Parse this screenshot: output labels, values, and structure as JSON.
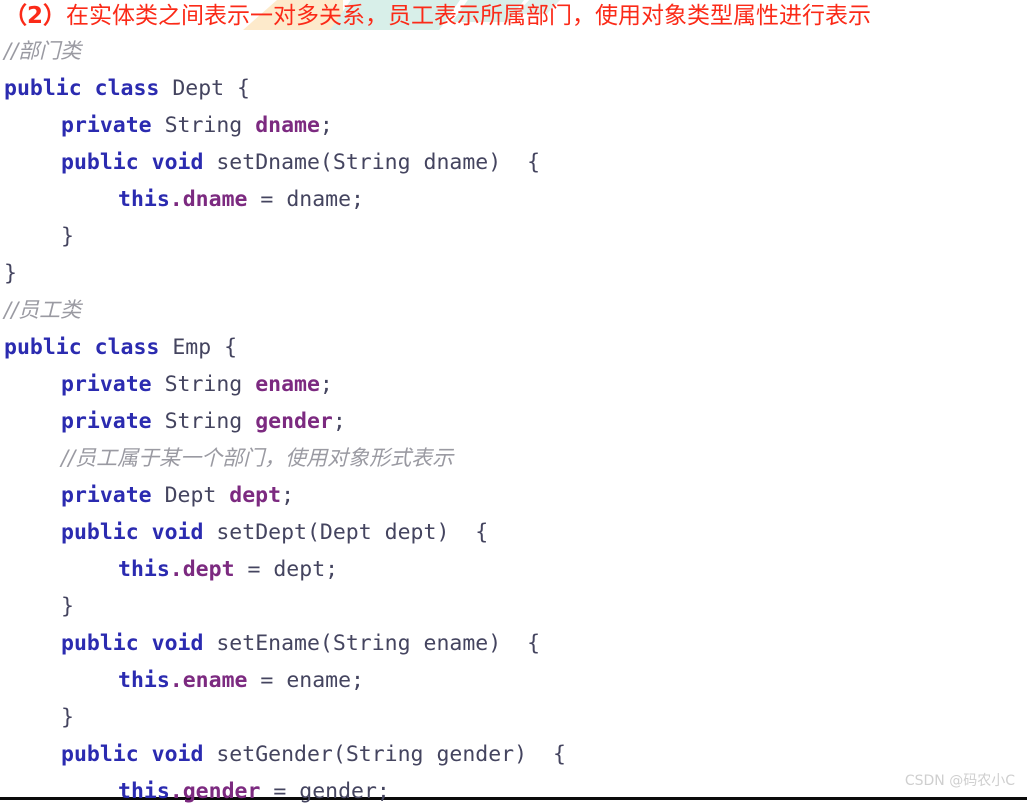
{
  "heading": {
    "index_label": "（2）",
    "text": "在实体类之间表示一对多关系，员工表示所属部门，使用对象类型属性进行表示",
    "color": "#fb2a18",
    "highlights": [
      {
        "name": "cream-wedge",
        "color": "#fdeacb"
      },
      {
        "name": "cyan-stroke-1",
        "color": "#d8efe9"
      },
      {
        "name": "cyan-stroke-2",
        "color": "#d8efe9"
      },
      {
        "name": "cyan-stroke-3",
        "color": "#dff0ec"
      }
    ]
  },
  "syntax_colors": {
    "keyword": "#2b2bb0",
    "type": "#44445f",
    "field": "#7c2a80",
    "comment": "#9a9aa2",
    "punctuation": "#44445f"
  },
  "code": {
    "language": "Java",
    "lines": [
      {
        "n": 1,
        "indent": 0,
        "tokens": [
          {
            "t": "//部门类",
            "c": "cmt"
          }
        ]
      },
      {
        "n": 2,
        "indent": 0,
        "tokens": [
          {
            "t": "public",
            "c": "kw"
          },
          {
            "t": " ",
            "c": "pun"
          },
          {
            "t": "class",
            "c": "kw"
          },
          {
            "t": " ",
            "c": "pun"
          },
          {
            "t": "Dept",
            "c": "typ"
          },
          {
            "t": " {",
            "c": "pun"
          }
        ]
      },
      {
        "n": 3,
        "indent": 1,
        "tokens": [
          {
            "t": "private",
            "c": "kw"
          },
          {
            "t": " ",
            "c": "pun"
          },
          {
            "t": "String",
            "c": "typ"
          },
          {
            "t": " ",
            "c": "pun"
          },
          {
            "t": "dname",
            "c": "fld"
          },
          {
            "t": ";",
            "c": "pun"
          }
        ]
      },
      {
        "n": 4,
        "indent": 1,
        "tokens": [
          {
            "t": "public",
            "c": "kw"
          },
          {
            "t": " ",
            "c": "pun"
          },
          {
            "t": "void",
            "c": "kw"
          },
          {
            "t": " ",
            "c": "pun"
          },
          {
            "t": "setDname",
            "c": "mth"
          },
          {
            "t": "(",
            "c": "pun"
          },
          {
            "t": "String",
            "c": "typ"
          },
          {
            "t": " ",
            "c": "pun"
          },
          {
            "t": "dname",
            "c": "var"
          },
          {
            "t": ")  {",
            "c": "pun"
          }
        ]
      },
      {
        "n": 5,
        "indent": 2,
        "tokens": [
          {
            "t": "this",
            "c": "kw"
          },
          {
            "t": ".",
            "c": "fld"
          },
          {
            "t": "dname",
            "c": "fld"
          },
          {
            "t": " = ",
            "c": "pun"
          },
          {
            "t": "dname",
            "c": "var"
          },
          {
            "t": ";",
            "c": "pun"
          }
        ]
      },
      {
        "n": 6,
        "indent": 1,
        "tokens": [
          {
            "t": "}",
            "c": "pun"
          }
        ]
      },
      {
        "n": 7,
        "indent": 0,
        "tokens": [
          {
            "t": "}",
            "c": "pun"
          }
        ]
      },
      {
        "n": 8,
        "indent": 0,
        "tokens": [
          {
            "t": "//员工类",
            "c": "cmt"
          }
        ]
      },
      {
        "n": 9,
        "indent": 0,
        "tokens": [
          {
            "t": "public",
            "c": "kw"
          },
          {
            "t": " ",
            "c": "pun"
          },
          {
            "t": "class",
            "c": "kw"
          },
          {
            "t": " ",
            "c": "pun"
          },
          {
            "t": "Emp",
            "c": "typ"
          },
          {
            "t": " {",
            "c": "pun"
          }
        ]
      },
      {
        "n": 10,
        "indent": 1,
        "tokens": [
          {
            "t": "private",
            "c": "kw"
          },
          {
            "t": " ",
            "c": "pun"
          },
          {
            "t": "String",
            "c": "typ"
          },
          {
            "t": " ",
            "c": "pun"
          },
          {
            "t": "ename",
            "c": "fld"
          },
          {
            "t": ";",
            "c": "pun"
          }
        ]
      },
      {
        "n": 11,
        "indent": 1,
        "tokens": [
          {
            "t": "private",
            "c": "kw"
          },
          {
            "t": " ",
            "c": "pun"
          },
          {
            "t": "String",
            "c": "typ"
          },
          {
            "t": " ",
            "c": "pun"
          },
          {
            "t": "gender",
            "c": "fld"
          },
          {
            "t": ";",
            "c": "pun"
          }
        ]
      },
      {
        "n": 12,
        "indent": 1,
        "tokens": [
          {
            "t": "//员工属于某一个部门，使用对象形式表示",
            "c": "cmt"
          }
        ]
      },
      {
        "n": 13,
        "indent": 1,
        "tokens": [
          {
            "t": "private",
            "c": "kw"
          },
          {
            "t": " ",
            "c": "pun"
          },
          {
            "t": "Dept",
            "c": "typ"
          },
          {
            "t": " ",
            "c": "pun"
          },
          {
            "t": "dept",
            "c": "fld"
          },
          {
            "t": ";",
            "c": "pun"
          }
        ]
      },
      {
        "n": 14,
        "indent": 1,
        "tokens": [
          {
            "t": "public",
            "c": "kw"
          },
          {
            "t": " ",
            "c": "pun"
          },
          {
            "t": "void",
            "c": "kw"
          },
          {
            "t": " ",
            "c": "pun"
          },
          {
            "t": "setDept",
            "c": "mth"
          },
          {
            "t": "(",
            "c": "pun"
          },
          {
            "t": "Dept",
            "c": "typ"
          },
          {
            "t": " ",
            "c": "pun"
          },
          {
            "t": "dept",
            "c": "var"
          },
          {
            "t": ")  {",
            "c": "pun"
          }
        ]
      },
      {
        "n": 15,
        "indent": 2,
        "tokens": [
          {
            "t": "this",
            "c": "kw"
          },
          {
            "t": ".",
            "c": "fld"
          },
          {
            "t": "dept",
            "c": "fld"
          },
          {
            "t": " = ",
            "c": "pun"
          },
          {
            "t": "dept",
            "c": "var"
          },
          {
            "t": ";",
            "c": "pun"
          }
        ]
      },
      {
        "n": 16,
        "indent": 1,
        "tokens": [
          {
            "t": "}",
            "c": "pun"
          }
        ]
      },
      {
        "n": 17,
        "indent": 1,
        "tokens": [
          {
            "t": "public",
            "c": "kw"
          },
          {
            "t": " ",
            "c": "pun"
          },
          {
            "t": "void",
            "c": "kw"
          },
          {
            "t": " ",
            "c": "pun"
          },
          {
            "t": "setEname",
            "c": "mth"
          },
          {
            "t": "(",
            "c": "pun"
          },
          {
            "t": "String",
            "c": "typ"
          },
          {
            "t": " ",
            "c": "pun"
          },
          {
            "t": "ename",
            "c": "var"
          },
          {
            "t": ")  {",
            "c": "pun"
          }
        ]
      },
      {
        "n": 18,
        "indent": 2,
        "tokens": [
          {
            "t": "this",
            "c": "kw"
          },
          {
            "t": ".",
            "c": "fld"
          },
          {
            "t": "ename",
            "c": "fld"
          },
          {
            "t": " = ",
            "c": "pun"
          },
          {
            "t": "ename",
            "c": "var"
          },
          {
            "t": ";",
            "c": "pun"
          }
        ]
      },
      {
        "n": 19,
        "indent": 1,
        "tokens": [
          {
            "t": "}",
            "c": "pun"
          }
        ]
      },
      {
        "n": 20,
        "indent": 1,
        "tokens": [
          {
            "t": "public",
            "c": "kw"
          },
          {
            "t": " ",
            "c": "pun"
          },
          {
            "t": "void",
            "c": "kw"
          },
          {
            "t": " ",
            "c": "pun"
          },
          {
            "t": "setGender",
            "c": "mth"
          },
          {
            "t": "(",
            "c": "pun"
          },
          {
            "t": "String",
            "c": "typ"
          },
          {
            "t": " ",
            "c": "pun"
          },
          {
            "t": "gender",
            "c": "var"
          },
          {
            "t": ")  {",
            "c": "pun"
          }
        ]
      },
      {
        "n": 21,
        "indent": 2,
        "tokens": [
          {
            "t": "this",
            "c": "kw"
          },
          {
            "t": ".",
            "c": "fld"
          },
          {
            "t": "gender",
            "c": "fld"
          },
          {
            "t": " = ",
            "c": "pun"
          },
          {
            "t": "gender",
            "c": "var"
          },
          {
            "t": ";",
            "c": "pun"
          }
        ]
      }
    ]
  },
  "watermark": {
    "text": "CSDN @码农小C",
    "color": "#cfcfcf"
  }
}
